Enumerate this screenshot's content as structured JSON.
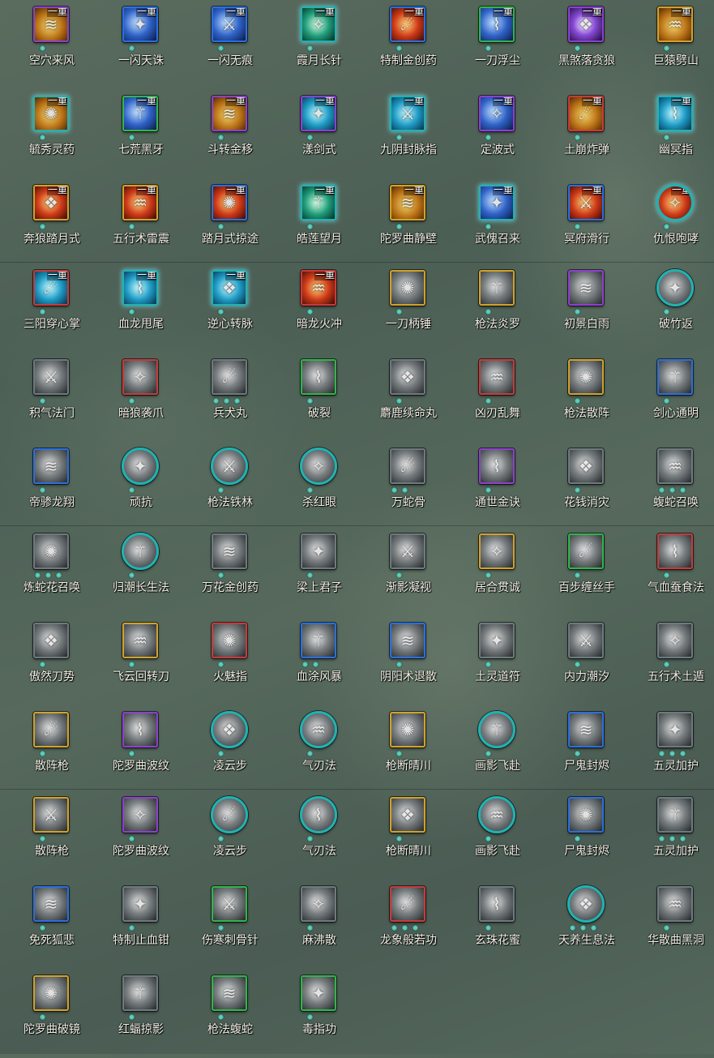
{
  "grid": {
    "colors": {
      "purple": "#8e3fd0",
      "blue": "#2a6fe0",
      "teal": "#1fb3b3",
      "green": "#2fb64a",
      "red": "#c93a3a",
      "gold": "#d1a22a",
      "gray": "#6d7a80"
    },
    "skills": [
      {
        "label": "空穴来风",
        "tier": "一重",
        "frame": "purple",
        "shape": "square",
        "art": "gold",
        "icon": "wind-hole-icon",
        "dots": 1
      },
      {
        "label": "一闪天诛",
        "tier": "一重",
        "frame": "blue",
        "shape": "square",
        "art": "blue",
        "icon": "flash-strike-icon",
        "dots": 1
      },
      {
        "label": "一闪无痕",
        "tier": "一重",
        "frame": "blue",
        "shape": "square",
        "art": "blue",
        "icon": "traceless-strike-icon",
        "dots": 1
      },
      {
        "label": "霞月长针",
        "tier": "一重",
        "frame": "teal",
        "shape": "square",
        "art": "green",
        "icon": "long-needle-icon",
        "dots": 1
      },
      {
        "label": "特制金创药",
        "tier": "一重",
        "frame": "blue",
        "shape": "square",
        "art": "red",
        "icon": "healing-potion-icon",
        "dots": 1
      },
      {
        "label": "一刀浮尘",
        "tier": "一重",
        "frame": "green",
        "shape": "square",
        "art": "blue",
        "icon": "blade-dust-icon",
        "dots": 1
      },
      {
        "label": "黑煞落贪狼",
        "tier": "一重",
        "frame": "purple",
        "shape": "square",
        "art": "purple",
        "icon": "wolf-strike-icon",
        "dots": 1
      },
      {
        "label": "巨猿劈山",
        "tier": "一重",
        "frame": "gold",
        "shape": "square",
        "art": "gold",
        "icon": "ape-cleave-icon",
        "dots": 1
      },
      {
        "label": "毓秀灵药",
        "tier": "一重",
        "frame": "teal",
        "shape": "square",
        "art": "gold",
        "icon": "gourd-elixir-icon",
        "dots": 1
      },
      {
        "label": "七荒黑牙",
        "tier": "一重",
        "frame": "green",
        "shape": "square",
        "art": "blue",
        "icon": "black-fang-icon",
        "dots": 1
      },
      {
        "label": "斗转金移",
        "tier": "一重",
        "frame": "purple",
        "shape": "square",
        "art": "gold",
        "icon": "gold-shift-icon",
        "dots": 1
      },
      {
        "label": "漾剑式",
        "tier": "一重",
        "frame": "purple",
        "shape": "square",
        "art": "teal",
        "icon": "sword-ripple-icon",
        "dots": 1
      },
      {
        "label": "九阴封脉指",
        "tier": "一重",
        "frame": "teal",
        "shape": "square",
        "art": "teal",
        "icon": "meridian-seal-icon",
        "dots": 1
      },
      {
        "label": "定波式",
        "tier": "一重",
        "frame": "purple",
        "shape": "square",
        "art": "blue",
        "icon": "wave-calm-icon",
        "dots": 1
      },
      {
        "label": "土崩炸弹",
        "tier": "一重",
        "frame": "red",
        "shape": "square",
        "art": "gold",
        "icon": "earth-bomb-icon",
        "dots": 1
      },
      {
        "label": "幽冥指",
        "tier": "一重",
        "frame": "teal",
        "shape": "square",
        "art": "teal",
        "icon": "nether-finger-icon",
        "dots": 1
      },
      {
        "label": "奔狼踏月式",
        "tier": "一重",
        "frame": "gold",
        "shape": "square",
        "art": "red",
        "icon": "running-wolf-icon",
        "dots": 1
      },
      {
        "label": "五行术雷震",
        "tier": "一重",
        "frame": "gold",
        "shape": "square",
        "art": "red",
        "icon": "thunder-rite-icon",
        "dots": 1
      },
      {
        "label": "踏月式掠途",
        "tier": "一重",
        "frame": "blue",
        "shape": "square",
        "art": "red",
        "icon": "moon-dash-icon",
        "dots": 1
      },
      {
        "label": "皓莲望月",
        "tier": "一重",
        "frame": "teal",
        "shape": "square",
        "art": "green",
        "icon": "lotus-moon-icon",
        "dots": 1
      },
      {
        "label": "陀罗曲静壁",
        "tier": "一重",
        "frame": "gold",
        "shape": "square",
        "art": "gold",
        "icon": "still-wall-icon",
        "dots": 1
      },
      {
        "label": "武傀召来",
        "tier": "一重",
        "frame": "teal",
        "shape": "square",
        "art": "blue",
        "icon": "puppet-summon-icon",
        "dots": 1
      },
      {
        "label": "冥府滑行",
        "tier": "一重",
        "frame": "blue",
        "shape": "square",
        "art": "red",
        "icon": "underworld-glide-icon",
        "dots": 1
      },
      {
        "label": "仇恨咆哮",
        "tier": "一重",
        "frame": "teal",
        "shape": "round",
        "art": "red",
        "icon": "roar-icon",
        "dots": 1
      },
      {
        "label": "三阳穿心掌",
        "tier": "一重",
        "frame": "red",
        "shape": "square",
        "art": "teal",
        "icon": "heart-palm-icon",
        "dots": 1
      },
      {
        "label": "血龙甩尾",
        "tier": "一重",
        "frame": "teal",
        "shape": "square",
        "art": "teal",
        "icon": "dragon-tail-icon",
        "dots": 1
      },
      {
        "label": "逆心转脉",
        "tier": "一重",
        "frame": "teal",
        "shape": "square",
        "art": "teal",
        "icon": "reverse-pulse-icon",
        "dots": 1
      },
      {
        "label": "暗龙火冲",
        "tier": "一重",
        "frame": "red",
        "shape": "square",
        "art": "red",
        "icon": "dark-dragon-fire-icon",
        "dots": 1
      },
      {
        "label": "一刀柄锤",
        "tier": "",
        "frame": "gold",
        "shape": "square",
        "art": "gray",
        "icon": "hilt-hammer-icon",
        "dots": 1
      },
      {
        "label": "枪法炎罗",
        "tier": "",
        "frame": "gold",
        "shape": "square",
        "art": "gray",
        "icon": "spear-flame-icon",
        "dots": 1
      },
      {
        "label": "初景白雨",
        "tier": "",
        "frame": "purple",
        "shape": "square",
        "art": "gray",
        "icon": "white-rain-icon",
        "dots": 1
      },
      {
        "label": "破竹返",
        "tier": "",
        "frame": "teal",
        "shape": "round",
        "art": "gray",
        "icon": "bamboo-return-icon",
        "dots": 1
      },
      {
        "label": "积气法门",
        "tier": "",
        "frame": "gray",
        "shape": "square",
        "art": "gray",
        "icon": "qi-gate-icon",
        "dots": 1
      },
      {
        "label": "暗狼袭爪",
        "tier": "",
        "frame": "red",
        "shape": "square",
        "art": "gray",
        "icon": "wolf-claw-icon",
        "dots": 1
      },
      {
        "label": "兵犬丸",
        "tier": "",
        "frame": "gray",
        "shape": "square",
        "art": "gray",
        "icon": "hound-pill-icon",
        "dots": 3
      },
      {
        "label": "破裂",
        "tier": "",
        "frame": "green",
        "shape": "square",
        "art": "gray",
        "icon": "rupture-icon",
        "dots": 1
      },
      {
        "label": "麝鹿续命丸",
        "tier": "",
        "frame": "gray",
        "shape": "square",
        "art": "gray",
        "icon": "musk-pill-icon",
        "dots": 1
      },
      {
        "label": "凶刃乱舞",
        "tier": "",
        "frame": "red",
        "shape": "square",
        "art": "gray",
        "icon": "blade-dance-icon",
        "dots": 1
      },
      {
        "label": "枪法散阵",
        "tier": "",
        "frame": "gold",
        "shape": "square",
        "art": "gray",
        "icon": "spear-scatter-icon",
        "dots": 1
      },
      {
        "label": "剑心通明",
        "tier": "",
        "frame": "blue",
        "shape": "square",
        "art": "gray",
        "icon": "sword-heart-icon",
        "dots": 1
      },
      {
        "label": "帝骖龙翔",
        "tier": "",
        "frame": "blue",
        "shape": "square",
        "art": "gray",
        "icon": "dragon-soar-icon",
        "dots": 1
      },
      {
        "label": "顽抗",
        "tier": "",
        "frame": "teal",
        "shape": "round",
        "art": "gray",
        "icon": "resist-icon",
        "dots": 1
      },
      {
        "label": "枪法铁林",
        "tier": "",
        "frame": "teal",
        "shape": "round",
        "art": "gray",
        "icon": "iron-forest-icon",
        "dots": 1
      },
      {
        "label": "杀红眼",
        "tier": "",
        "frame": "teal",
        "shape": "round",
        "art": "gray",
        "icon": "red-eye-icon",
        "dots": 1
      },
      {
        "label": "万蛇骨",
        "tier": "",
        "frame": "gray",
        "shape": "square",
        "art": "gray",
        "icon": "snake-bone-icon",
        "dots": 2
      },
      {
        "label": "通世金诀",
        "tier": "",
        "frame": "purple",
        "shape": "square",
        "art": "gray",
        "icon": "gold-formula-icon",
        "dots": 1
      },
      {
        "label": "花钱消灾",
        "tier": "",
        "frame": "gray",
        "shape": "square",
        "art": "gray",
        "icon": "coin-pouch-icon",
        "dots": 1
      },
      {
        "label": "蝮蛇召唤",
        "tier": "",
        "frame": "gray",
        "shape": "square",
        "art": "gray",
        "icon": "viper-summon-icon",
        "dots": 3
      },
      {
        "label": "炼蛇花召唤",
        "tier": "",
        "frame": "gray",
        "shape": "square",
        "art": "gray",
        "icon": "snake-flower-icon",
        "dots": 3
      },
      {
        "label": "归潮长生法",
        "tier": "",
        "frame": "teal",
        "shape": "round",
        "art": "gray",
        "icon": "tide-life-icon",
        "dots": 1
      },
      {
        "label": "万花金创药",
        "tier": "",
        "frame": "gray",
        "shape": "square",
        "art": "gray",
        "icon": "flower-salve-icon",
        "dots": 1
      },
      {
        "label": "梁上君子",
        "tier": "",
        "frame": "gray",
        "shape": "square",
        "art": "gray",
        "icon": "thief-icon",
        "dots": 1
      },
      {
        "label": "渐影凝视",
        "tier": "",
        "frame": "gray",
        "shape": "square",
        "art": "gray",
        "icon": "shadow-gaze-icon",
        "dots": 1
      },
      {
        "label": "居合贯诚",
        "tier": "",
        "frame": "gold",
        "shape": "square",
        "art": "gray",
        "icon": "iai-strike-icon",
        "dots": 1
      },
      {
        "label": "百步缠丝手",
        "tier": "",
        "frame": "green",
        "shape": "square",
        "art": "gray",
        "icon": "silk-hand-icon",
        "dots": 1
      },
      {
        "label": "气血蚕食法",
        "tier": "",
        "frame": "red",
        "shape": "square",
        "art": "gray",
        "icon": "blood-drain-icon",
        "dots": 1
      },
      {
        "label": "傲然刀势",
        "tier": "",
        "frame": "gray",
        "shape": "square",
        "art": "gray",
        "icon": "proud-blade-icon",
        "dots": 1
      },
      {
        "label": "飞云回转刀",
        "tier": "",
        "frame": "gold",
        "shape": "square",
        "art": "gray",
        "icon": "cloud-blade-icon",
        "dots": 1
      },
      {
        "label": "火魅指",
        "tier": "",
        "frame": "red",
        "shape": "square",
        "art": "gray",
        "icon": "fire-finger-icon",
        "dots": 1
      },
      {
        "label": "血涂风暴",
        "tier": "",
        "frame": "blue",
        "shape": "square",
        "art": "gray",
        "icon": "blood-storm-icon",
        "dots": 2
      },
      {
        "label": "阴阳术退散",
        "tier": "",
        "frame": "blue",
        "shape": "square",
        "art": "gray",
        "icon": "yinyang-icon",
        "dots": 1
      },
      {
        "label": "土灵道符",
        "tier": "",
        "frame": "gray",
        "shape": "square",
        "art": "gray",
        "icon": "earth-talisman-icon",
        "dots": 1
      },
      {
        "label": "内力潮汐",
        "tier": "",
        "frame": "gray",
        "shape": "square",
        "art": "gray",
        "icon": "inner-tide-icon",
        "dots": 1
      },
      {
        "label": "五行术土遁",
        "tier": "",
        "frame": "gray",
        "shape": "square",
        "art": "gray",
        "icon": "earth-escape-icon",
        "dots": 1
      },
      {
        "label": "散阵枪",
        "tier": "",
        "frame": "gold",
        "shape": "square",
        "art": "gray",
        "icon": "scatter-spear-icon",
        "dots": 1
      },
      {
        "label": "陀罗曲波纹",
        "tier": "",
        "frame": "purple",
        "shape": "square",
        "art": "gray",
        "icon": "ripple-song-icon",
        "dots": 1
      },
      {
        "label": "凌云步",
        "tier": "",
        "frame": "teal",
        "shape": "round",
        "art": "gray",
        "icon": "cloud-step-icon",
        "dots": 1
      },
      {
        "label": "气刃法",
        "tier": "",
        "frame": "teal",
        "shape": "round",
        "art": "gray",
        "icon": "qi-blade-icon",
        "dots": 1
      },
      {
        "label": "枪断晴川",
        "tier": "",
        "frame": "gold",
        "shape": "square",
        "art": "gray",
        "icon": "spear-river-icon",
        "dots": 1
      },
      {
        "label": "画影飞赴",
        "tier": "",
        "frame": "teal",
        "shape": "round",
        "art": "gray",
        "icon": "shadow-fly-icon",
        "dots": 1
      },
      {
        "label": "尸鬼封烬",
        "tier": "",
        "frame": "blue",
        "shape": "square",
        "art": "gray",
        "icon": "ghoul-seal-icon",
        "dots": 1
      },
      {
        "label": "五灵加护",
        "tier": "",
        "frame": "gray",
        "shape": "square",
        "art": "gray",
        "icon": "five-spirits-icon",
        "dots": 3
      },
      {
        "label": "散阵枪",
        "tier": "",
        "frame": "gold",
        "shape": "square",
        "art": "gray",
        "icon": "scatter-spear-icon",
        "dots": 1
      },
      {
        "label": "陀罗曲波纹",
        "tier": "",
        "frame": "purple",
        "shape": "square",
        "art": "gray",
        "icon": "ripple-song-icon",
        "dots": 1
      },
      {
        "label": "凌云步",
        "tier": "",
        "frame": "teal",
        "shape": "round",
        "art": "gray",
        "icon": "cloud-step-icon",
        "dots": 1
      },
      {
        "label": "气刃法",
        "tier": "",
        "frame": "teal",
        "shape": "round",
        "art": "gray",
        "icon": "qi-blade-icon",
        "dots": 1
      },
      {
        "label": "枪断晴川",
        "tier": "",
        "frame": "gold",
        "shape": "square",
        "art": "gray",
        "icon": "spear-river-icon",
        "dots": 1
      },
      {
        "label": "画影飞赴",
        "tier": "",
        "frame": "teal",
        "shape": "round",
        "art": "gray",
        "icon": "shadow-fly-icon",
        "dots": 1
      },
      {
        "label": "尸鬼封烬",
        "tier": "",
        "frame": "blue",
        "shape": "square",
        "art": "gray",
        "icon": "ghoul-seal-icon",
        "dots": 1
      },
      {
        "label": "五灵加护",
        "tier": "",
        "frame": "gray",
        "shape": "square",
        "art": "gray",
        "icon": "five-spirits-icon",
        "dots": 3
      },
      {
        "label": "免死狐悲",
        "tier": "",
        "frame": "blue",
        "shape": "square",
        "art": "gray",
        "icon": "fox-grief-icon",
        "dots": 1
      },
      {
        "label": "特制止血钳",
        "tier": "",
        "frame": "gray",
        "shape": "square",
        "art": "gray",
        "icon": "hemostat-icon",
        "dots": 1
      },
      {
        "label": "伤寒刺骨针",
        "tier": "",
        "frame": "green",
        "shape": "square",
        "art": "gray",
        "icon": "bone-needle-icon",
        "dots": 1
      },
      {
        "label": "麻沸散",
        "tier": "",
        "frame": "gray",
        "shape": "square",
        "art": "gray",
        "icon": "numbing-powder-icon",
        "dots": 1
      },
      {
        "label": "龙象般若功",
        "tier": "",
        "frame": "red",
        "shape": "square",
        "art": "gray",
        "icon": "dragon-elephant-icon",
        "dots": 3
      },
      {
        "label": "玄珠花蜜",
        "tier": "",
        "frame": "gray",
        "shape": "square",
        "art": "gray",
        "icon": "pearl-nectar-icon",
        "dots": 1
      },
      {
        "label": "天养生息法",
        "tier": "",
        "frame": "teal",
        "shape": "round",
        "art": "gray",
        "icon": "heaven-breath-icon",
        "dots": 3
      },
      {
        "label": "华散曲黑洞",
        "tier": "",
        "frame": "gray",
        "shape": "square",
        "art": "gray",
        "icon": "black-hole-icon",
        "dots": 1
      },
      {
        "label": "陀罗曲破镜",
        "tier": "",
        "frame": "gold",
        "shape": "square",
        "art": "gray",
        "icon": "broken-mirror-icon",
        "dots": 1
      },
      {
        "label": "红蝠掠影",
        "tier": "",
        "frame": "gray",
        "shape": "square",
        "art": "gray",
        "icon": "red-bat-icon",
        "dots": 1
      },
      {
        "label": "枪法蝮蛇",
        "tier": "",
        "frame": "green",
        "shape": "square",
        "art": "gray",
        "icon": "spear-viper-icon",
        "dots": 1
      },
      {
        "label": "毒指功",
        "tier": "",
        "frame": "green",
        "shape": "square",
        "art": "gray",
        "icon": "poison-finger-icon",
        "dots": 1
      }
    ]
  }
}
